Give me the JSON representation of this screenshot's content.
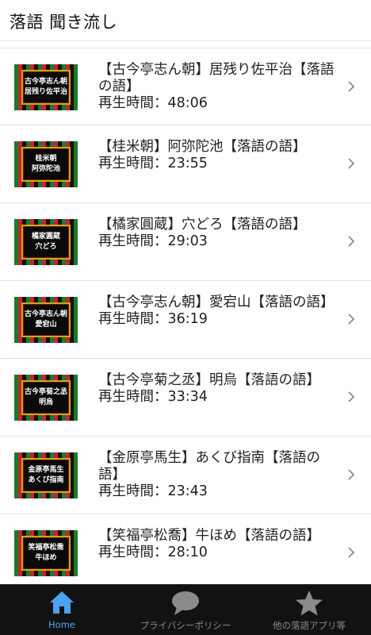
{
  "header": {
    "title": "落語 聞き流し"
  },
  "items": [
    {
      "title": "【古今亭志ん朝】居残り佐平治【落語の語】",
      "duration_label": "再生時間：",
      "duration": "48:06",
      "thumb": [
        "古今亭志ん朝",
        "居残り佐平治"
      ]
    },
    {
      "title": "【桂米朝】阿弥陀池【落語の語】",
      "duration_label": "再生時間：",
      "duration": "23:55",
      "thumb": [
        "桂米朝",
        "阿弥陀池"
      ]
    },
    {
      "title": "【橘家圓蔵】穴どろ【落語の語】",
      "duration_label": "再生時間：",
      "duration": "29:03",
      "thumb": [
        "橘家圓蔵",
        "穴どろ"
      ]
    },
    {
      "title": "【古今亭志ん朝】愛宕山【落語の語】",
      "duration_label": "再生時間：",
      "duration": "36:19",
      "thumb": [
        "古今亭志ん朝",
        "愛宕山"
      ]
    },
    {
      "title": "【古今亭菊之丞】明烏【落語の語】",
      "duration_label": "再生時間：",
      "duration": "33:34",
      "thumb": [
        "古今亭菊之丞",
        "明烏"
      ]
    },
    {
      "title": "【金原亭馬生】あくび指南【落語の語】",
      "duration_label": "再生時間：",
      "duration": "23:43",
      "thumb": [
        "金原亭馬生",
        "あくび指南"
      ]
    },
    {
      "title": "【笑福亭松喬】牛ほめ【落語の語】",
      "duration_label": "再生時間：",
      "duration": "28:10",
      "thumb": [
        "笑福亭松喬",
        "牛ほめ"
      ]
    }
  ],
  "tabs": [
    {
      "label": "Home",
      "icon": "home-icon",
      "active": true
    },
    {
      "label": "プライバシーポリシー",
      "icon": "speech-bubble-icon",
      "active": false
    },
    {
      "label": "他の落語アプリ等",
      "icon": "star-icon",
      "active": false
    }
  ],
  "colors": {
    "accent": "#4aa3f0",
    "tabbar_bg": "#121212",
    "tab_inactive": "#8a8a8a"
  }
}
